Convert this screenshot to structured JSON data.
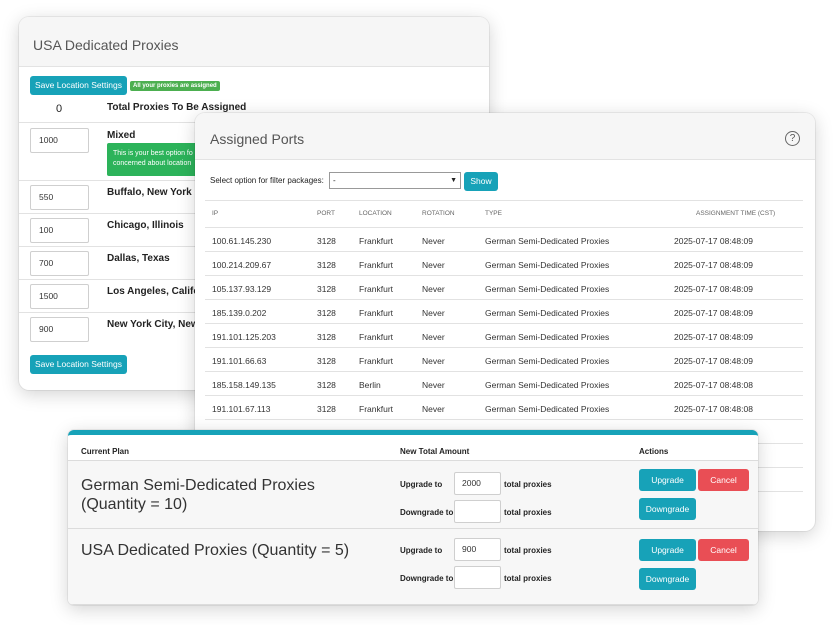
{
  "usa_panel": {
    "title": "USA Dedicated Proxies",
    "save_button": "Save Location Settings",
    "assigned_badge": "All your proxies are assigned",
    "total_count": "0",
    "total_label": "Total Proxies To Be Assigned",
    "mixed_note_line1": "This is your best option fo",
    "mixed_note_line2": "concerned about location",
    "locations": [
      {
        "value": "1000",
        "name": "Mixed"
      },
      {
        "value": "550",
        "name": "Buffalo, New York"
      },
      {
        "value": "100",
        "name": "Chicago, Illinois"
      },
      {
        "value": "700",
        "name": "Dallas, Texas"
      },
      {
        "value": "1500",
        "name": "Los Angeles, Californ"
      },
      {
        "value": "900",
        "name": "New York City, New Y"
      }
    ]
  },
  "ports_panel": {
    "title": "Assigned Ports",
    "help_icon": "question-circle-icon",
    "filter_label": "Select option for filter packages:",
    "filter_value": "-",
    "show_button": "Show",
    "headers": {
      "ip": "IP",
      "port": "PORT",
      "location": "LOCATION",
      "rotation": "ROTATION",
      "type": "TYPE",
      "time": "ASSIGNMENT TIME (CST)"
    },
    "rows": [
      {
        "ip": "100.61.145.230",
        "port": "3128",
        "location": "Frankfurt",
        "rotation": "Never",
        "type": "German Semi-Dedicated Proxies",
        "time": "2025-07-17 08:48:09"
      },
      {
        "ip": "100.214.209.67",
        "port": "3128",
        "location": "Frankfurt",
        "rotation": "Never",
        "type": "German Semi-Dedicated Proxies",
        "time": "2025-07-17 08:48:09"
      },
      {
        "ip": "105.137.93.129",
        "port": "3128",
        "location": "Frankfurt",
        "rotation": "Never",
        "type": "German Semi-Dedicated Proxies",
        "time": "2025-07-17 08:48:09"
      },
      {
        "ip": "185.139.0.202",
        "port": "3128",
        "location": "Frankfurt",
        "rotation": "Never",
        "type": "German Semi-Dedicated Proxies",
        "time": "2025-07-17 08:48:09"
      },
      {
        "ip": "191.101.125.203",
        "port": "3128",
        "location": "Frankfurt",
        "rotation": "Never",
        "type": "German Semi-Dedicated Proxies",
        "time": "2025-07-17 08:48:09"
      },
      {
        "ip": "191.101.66.63",
        "port": "3128",
        "location": "Frankfurt",
        "rotation": "Never",
        "type": "German Semi-Dedicated Proxies",
        "time": "2025-07-17 08:48:09"
      },
      {
        "ip": "185.158.149.135",
        "port": "3128",
        "location": "Berlin",
        "rotation": "Never",
        "type": "German Semi-Dedicated Proxies",
        "time": "2025-07-17 08:48:08"
      },
      {
        "ip": "191.101.67.113",
        "port": "3128",
        "location": "Frankfurt",
        "rotation": "Never",
        "type": "German Semi-Dedicated Proxies",
        "time": "2025-07-17 08:48:08"
      }
    ]
  },
  "plan_panel": {
    "headers": {
      "current_plan": "Current Plan",
      "new_total": "New Total Amount",
      "actions": "Actions"
    },
    "upgrade_to": "Upgrade to",
    "downgrade_to": "Downgrade to",
    "total_proxies": "total proxies",
    "upgrade_button": "Upgrade",
    "cancel_button": "Cancel",
    "downgrade_button": "Downgrade",
    "plans": [
      {
        "name_line1": "German Semi-Dedicated Proxies",
        "name_line2": "(Quantity = 10)",
        "upgrade_value": "2000",
        "downgrade_value": ""
      },
      {
        "name_line1": "USA Dedicated Proxies (Quantity = 5)",
        "name_line2": "",
        "upgrade_value": "900",
        "downgrade_value": ""
      }
    ]
  },
  "colors": {
    "accent": "#17a2b8",
    "danger": "#e94e55",
    "success": "#2cb35a"
  }
}
